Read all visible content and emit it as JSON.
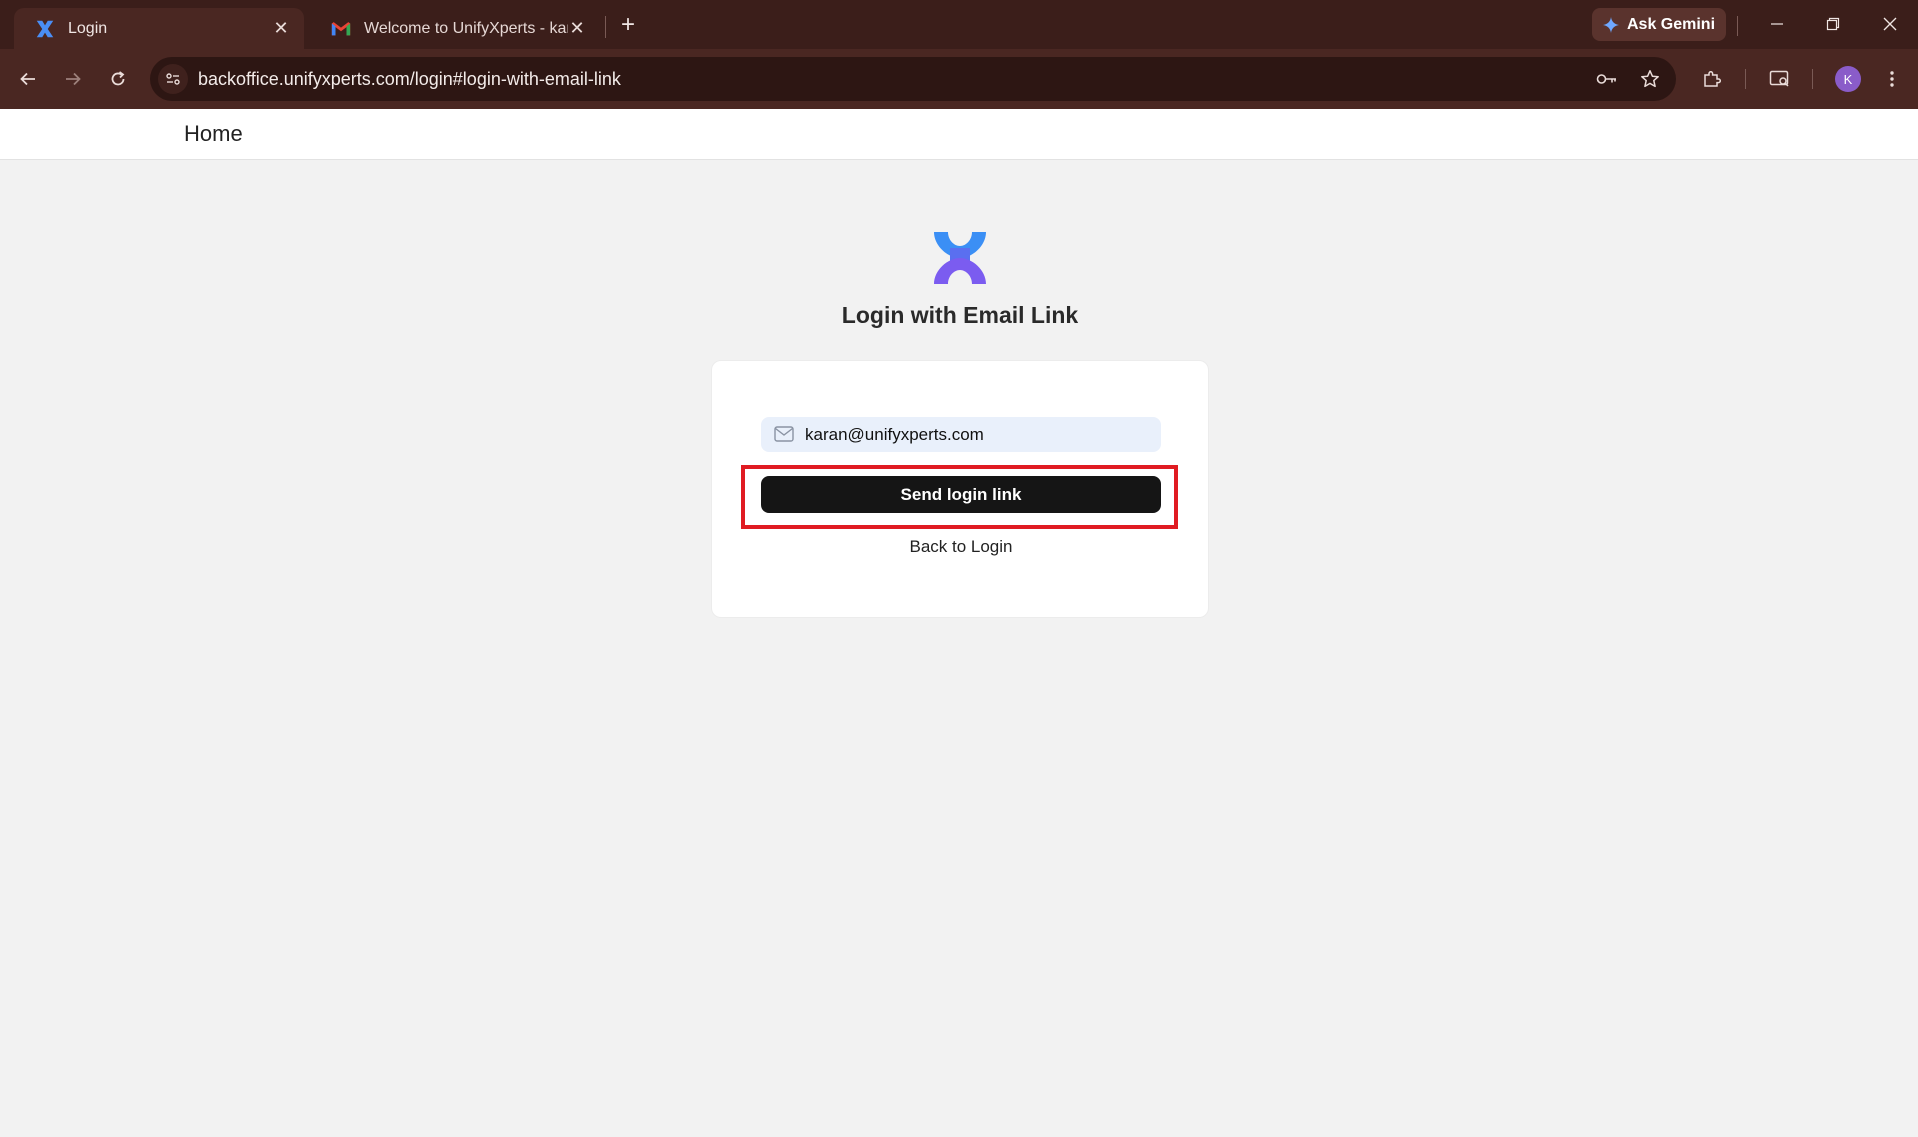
{
  "browser": {
    "tabs": [
      {
        "title": "Login",
        "active": true
      },
      {
        "title": "Welcome to UnifyXperts - karan",
        "active": false
      }
    ],
    "ask_gemini": "Ask Gemini",
    "url": "backoffice.unifyxperts.com/login#login-with-email-link",
    "profile_initial": "K"
  },
  "header": {
    "home_link": "Home"
  },
  "login": {
    "heading": "Login with Email Link",
    "email_value": "karan@unifyxperts.com",
    "send_button": "Send login link",
    "back_link": "Back to Login"
  },
  "colors": {
    "browser_frame": "#3b1e1a",
    "toolbar": "#4a2722",
    "button_bg": "#151515",
    "input_bg": "#e9f0fb",
    "highlight": "#e01b22",
    "logo_blue": "#3b8ff5",
    "logo_purple": "#7b5cf0"
  }
}
